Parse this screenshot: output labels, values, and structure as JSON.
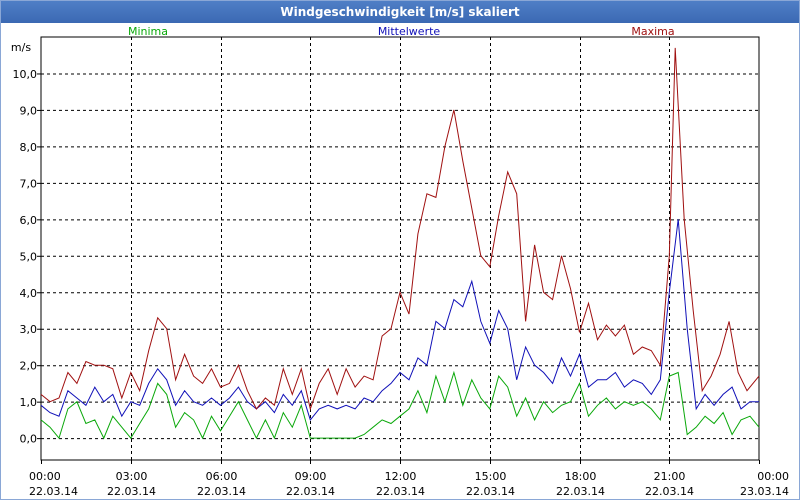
{
  "window": {
    "title": "Windgeschwindigkeit [m/s] skaliert"
  },
  "colors": {
    "minima": "#0aa80a",
    "mittel": "#1010b8",
    "maxima": "#a01010",
    "grid": "#000000"
  },
  "chart_data": {
    "type": "line",
    "title": "Windgeschwindigkeit [m/s] skaliert",
    "ylabel": "m/s",
    "ylim": [
      -0.6,
      11.0
    ],
    "yticks": [
      "0,0",
      "1,0",
      "2,0",
      "3,0",
      "4,0",
      "5,0",
      "6,0",
      "7,0",
      "8,0",
      "9,0",
      "10,0"
    ],
    "ytick_values": [
      0,
      1,
      2,
      3,
      4,
      5,
      6,
      7,
      8,
      9,
      10
    ],
    "xlim_hours": [
      0,
      24
    ],
    "xticks": [
      {
        "time": "00:00",
        "date": "22.03.14"
      },
      {
        "time": "03:00",
        "date": "22.03.14"
      },
      {
        "time": "06:00",
        "date": "22.03.14"
      },
      {
        "time": "09:00",
        "date": "22.03.14"
      },
      {
        "time": "12:00",
        "date": "22.03.14"
      },
      {
        "time": "15:00",
        "date": "22.03.14"
      },
      {
        "time": "18:00",
        "date": "22.03.14"
      },
      {
        "time": "21:00",
        "date": "22.03.14"
      },
      {
        "time": "00:00",
        "date": "23.03.14"
      }
    ],
    "grid": true,
    "legend": "top",
    "series": [
      {
        "name": "Minima",
        "color_key": "minima",
        "points": [
          [
            0.0,
            0.5
          ],
          [
            0.3,
            0.3
          ],
          [
            0.6,
            0.0
          ],
          [
            0.9,
            0.8
          ],
          [
            1.2,
            1.0
          ],
          [
            1.5,
            0.4
          ],
          [
            1.8,
            0.5
          ],
          [
            2.1,
            0.0
          ],
          [
            2.4,
            0.6
          ],
          [
            2.7,
            0.3
          ],
          [
            3.0,
            0.0
          ],
          [
            3.3,
            0.4
          ],
          [
            3.6,
            0.8
          ],
          [
            3.9,
            1.5
          ],
          [
            4.2,
            1.2
          ],
          [
            4.5,
            0.3
          ],
          [
            4.8,
            0.7
          ],
          [
            5.1,
            0.5
          ],
          [
            5.4,
            0.0
          ],
          [
            5.7,
            0.6
          ],
          [
            6.0,
            0.2
          ],
          [
            6.3,
            0.6
          ],
          [
            6.6,
            1.0
          ],
          [
            6.9,
            0.5
          ],
          [
            7.2,
            0.0
          ],
          [
            7.5,
            0.5
          ],
          [
            7.8,
            0.0
          ],
          [
            8.1,
            0.7
          ],
          [
            8.4,
            0.3
          ],
          [
            8.7,
            0.9
          ],
          [
            9.0,
            0.0
          ],
          [
            9.3,
            0.0
          ],
          [
            9.6,
            0.0
          ],
          [
            9.9,
            0.0
          ],
          [
            10.2,
            0.0
          ],
          [
            10.5,
            0.0
          ],
          [
            10.8,
            0.1
          ],
          [
            11.1,
            0.3
          ],
          [
            11.4,
            0.5
          ],
          [
            11.7,
            0.4
          ],
          [
            12.0,
            0.6
          ],
          [
            12.3,
            0.8
          ],
          [
            12.6,
            1.3
          ],
          [
            12.9,
            0.7
          ],
          [
            13.2,
            1.7
          ],
          [
            13.5,
            1.0
          ],
          [
            13.8,
            1.8
          ],
          [
            14.1,
            0.9
          ],
          [
            14.4,
            1.6
          ],
          [
            14.7,
            1.1
          ],
          [
            15.0,
            0.8
          ],
          [
            15.3,
            1.7
          ],
          [
            15.6,
            1.4
          ],
          [
            15.9,
            0.6
          ],
          [
            16.2,
            1.1
          ],
          [
            16.5,
            0.5
          ],
          [
            16.8,
            1.0
          ],
          [
            17.1,
            0.7
          ],
          [
            17.4,
            0.9
          ],
          [
            17.7,
            1.0
          ],
          [
            18.0,
            1.5
          ],
          [
            18.3,
            0.6
          ],
          [
            18.6,
            0.9
          ],
          [
            18.9,
            1.1
          ],
          [
            19.2,
            0.8
          ],
          [
            19.5,
            1.0
          ],
          [
            19.8,
            0.9
          ],
          [
            20.1,
            1.0
          ],
          [
            20.4,
            0.8
          ],
          [
            20.7,
            0.5
          ],
          [
            21.0,
            1.7
          ],
          [
            21.3,
            1.8
          ],
          [
            21.6,
            0.1
          ],
          [
            21.9,
            0.3
          ],
          [
            22.2,
            0.6
          ],
          [
            22.5,
            0.4
          ],
          [
            22.8,
            0.7
          ],
          [
            23.1,
            0.1
          ],
          [
            23.4,
            0.5
          ],
          [
            23.7,
            0.6
          ],
          [
            24.0,
            0.3
          ]
        ]
      },
      {
        "name": "Mittelwerte",
        "color_key": "mittel",
        "points": [
          [
            0.0,
            0.9
          ],
          [
            0.3,
            0.7
          ],
          [
            0.6,
            0.6
          ],
          [
            0.9,
            1.3
          ],
          [
            1.2,
            1.1
          ],
          [
            1.5,
            0.9
          ],
          [
            1.8,
            1.4
          ],
          [
            2.1,
            1.0
          ],
          [
            2.4,
            1.2
          ],
          [
            2.7,
            0.6
          ],
          [
            3.0,
            1.0
          ],
          [
            3.3,
            0.9
          ],
          [
            3.6,
            1.5
          ],
          [
            3.9,
            1.9
          ],
          [
            4.2,
            1.6
          ],
          [
            4.5,
            0.9
          ],
          [
            4.8,
            1.3
          ],
          [
            5.1,
            1.0
          ],
          [
            5.4,
            0.9
          ],
          [
            5.7,
            1.1
          ],
          [
            6.0,
            0.9
          ],
          [
            6.3,
            1.1
          ],
          [
            6.6,
            1.4
          ],
          [
            6.9,
            1.0
          ],
          [
            7.2,
            0.8
          ],
          [
            7.5,
            1.0
          ],
          [
            7.8,
            0.7
          ],
          [
            8.1,
            1.2
          ],
          [
            8.4,
            0.9
          ],
          [
            8.7,
            1.3
          ],
          [
            9.0,
            0.5
          ],
          [
            9.3,
            0.8
          ],
          [
            9.6,
            0.9
          ],
          [
            9.9,
            0.8
          ],
          [
            10.2,
            0.9
          ],
          [
            10.5,
            0.8
          ],
          [
            10.8,
            1.1
          ],
          [
            11.1,
            1.0
          ],
          [
            11.4,
            1.3
          ],
          [
            11.7,
            1.5
          ],
          [
            12.0,
            1.8
          ],
          [
            12.3,
            1.6
          ],
          [
            12.6,
            2.2
          ],
          [
            12.9,
            2.0
          ],
          [
            13.2,
            3.2
          ],
          [
            13.5,
            3.0
          ],
          [
            13.8,
            3.8
          ],
          [
            14.1,
            3.6
          ],
          [
            14.4,
            4.3
          ],
          [
            14.7,
            3.2
          ],
          [
            15.0,
            2.6
          ],
          [
            15.3,
            3.5
          ],
          [
            15.6,
            3.0
          ],
          [
            15.9,
            1.6
          ],
          [
            16.2,
            2.5
          ],
          [
            16.5,
            2.0
          ],
          [
            16.8,
            1.8
          ],
          [
            17.1,
            1.5
          ],
          [
            17.4,
            2.2
          ],
          [
            17.7,
            1.7
          ],
          [
            18.0,
            2.3
          ],
          [
            18.3,
            1.4
          ],
          [
            18.6,
            1.6
          ],
          [
            18.9,
            1.6
          ],
          [
            19.2,
            1.8
          ],
          [
            19.5,
            1.4
          ],
          [
            19.8,
            1.6
          ],
          [
            20.1,
            1.5
          ],
          [
            20.4,
            1.2
          ],
          [
            20.7,
            1.6
          ],
          [
            21.0,
            4.0
          ],
          [
            21.3,
            6.0
          ],
          [
            21.6,
            3.0
          ],
          [
            21.9,
            0.8
          ],
          [
            22.2,
            1.2
          ],
          [
            22.5,
            0.9
          ],
          [
            22.8,
            1.2
          ],
          [
            23.1,
            1.4
          ],
          [
            23.4,
            0.8
          ],
          [
            23.7,
            1.0
          ],
          [
            24.0,
            1.0
          ]
        ]
      },
      {
        "name": "Maxima",
        "color_key": "maxima",
        "points": [
          [
            0.0,
            1.2
          ],
          [
            0.3,
            1.0
          ],
          [
            0.6,
            1.1
          ],
          [
            0.9,
            1.8
          ],
          [
            1.2,
            1.5
          ],
          [
            1.5,
            2.1
          ],
          [
            1.8,
            2.0
          ],
          [
            2.1,
            2.0
          ],
          [
            2.4,
            1.9
          ],
          [
            2.7,
            1.1
          ],
          [
            3.0,
            1.8
          ],
          [
            3.3,
            1.3
          ],
          [
            3.6,
            2.4
          ],
          [
            3.9,
            3.3
          ],
          [
            4.2,
            3.0
          ],
          [
            4.5,
            1.6
          ],
          [
            4.8,
            2.3
          ],
          [
            5.1,
            1.7
          ],
          [
            5.4,
            1.5
          ],
          [
            5.7,
            1.9
          ],
          [
            6.0,
            1.4
          ],
          [
            6.3,
            1.5
          ],
          [
            6.6,
            2.0
          ],
          [
            6.9,
            1.3
          ],
          [
            7.2,
            0.8
          ],
          [
            7.5,
            1.1
          ],
          [
            7.8,
            0.9
          ],
          [
            8.1,
            1.9
          ],
          [
            8.4,
            1.2
          ],
          [
            8.7,
            1.9
          ],
          [
            9.0,
            0.8
          ],
          [
            9.3,
            1.5
          ],
          [
            9.6,
            1.9
          ],
          [
            9.9,
            1.2
          ],
          [
            10.2,
            1.9
          ],
          [
            10.5,
            1.4
          ],
          [
            10.8,
            1.7
          ],
          [
            11.1,
            1.6
          ],
          [
            11.4,
            2.8
          ],
          [
            11.7,
            3.0
          ],
          [
            12.0,
            4.0
          ],
          [
            12.3,
            3.4
          ],
          [
            12.6,
            5.6
          ],
          [
            12.9,
            6.7
          ],
          [
            13.2,
            6.6
          ],
          [
            13.5,
            8.0
          ],
          [
            13.8,
            9.0
          ],
          [
            14.1,
            7.6
          ],
          [
            14.4,
            6.3
          ],
          [
            14.7,
            5.0
          ],
          [
            15.0,
            4.7
          ],
          [
            15.3,
            6.1
          ],
          [
            15.6,
            7.3
          ],
          [
            15.9,
            6.7
          ],
          [
            16.2,
            3.2
          ],
          [
            16.5,
            5.3
          ],
          [
            16.8,
            4.0
          ],
          [
            17.1,
            3.8
          ],
          [
            17.4,
            5.0
          ],
          [
            17.7,
            4.1
          ],
          [
            18.0,
            2.9
          ],
          [
            18.3,
            3.7
          ],
          [
            18.6,
            2.7
          ],
          [
            18.9,
            3.1
          ],
          [
            19.2,
            2.8
          ],
          [
            19.5,
            3.1
          ],
          [
            19.8,
            2.3
          ],
          [
            20.1,
            2.5
          ],
          [
            20.4,
            2.4
          ],
          [
            20.7,
            2.0
          ],
          [
            21.0,
            5.0
          ],
          [
            21.2,
            10.7
          ],
          [
            21.5,
            6.0
          ],
          [
            21.8,
            3.5
          ],
          [
            22.1,
            1.3
          ],
          [
            22.4,
            1.7
          ],
          [
            22.7,
            2.3
          ],
          [
            23.0,
            3.2
          ],
          [
            23.3,
            1.8
          ],
          [
            23.6,
            1.3
          ],
          [
            24.0,
            1.7
          ]
        ]
      }
    ]
  }
}
